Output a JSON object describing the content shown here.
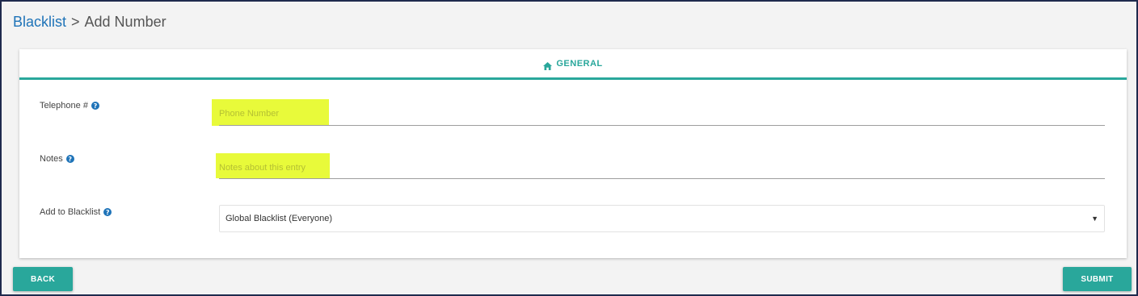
{
  "breadcrumb": {
    "parent": "Blacklist",
    "separator": ">",
    "current": "Add Number"
  },
  "tabs": [
    {
      "label": "GENERAL",
      "icon": "home-icon",
      "active": true
    }
  ],
  "form": {
    "telephone": {
      "label": "Telephone #",
      "placeholder": "Phone Number",
      "value": "",
      "help_icon": "question-circle-icon"
    },
    "notes": {
      "label": "Notes",
      "placeholder": "Notes about this entry",
      "value": "",
      "help_icon": "question-circle-icon"
    },
    "blacklist": {
      "label": "Add to Blacklist",
      "selected": "Global Blacklist (Everyone)",
      "help_icon": "question-circle-icon"
    }
  },
  "buttons": {
    "back": "BACK",
    "submit": "SUBMIT"
  },
  "colors": {
    "accent": "#29a79b",
    "link": "#1e73b8",
    "highlight": "#e8fa3a",
    "window_border": "#1f2a4d"
  }
}
